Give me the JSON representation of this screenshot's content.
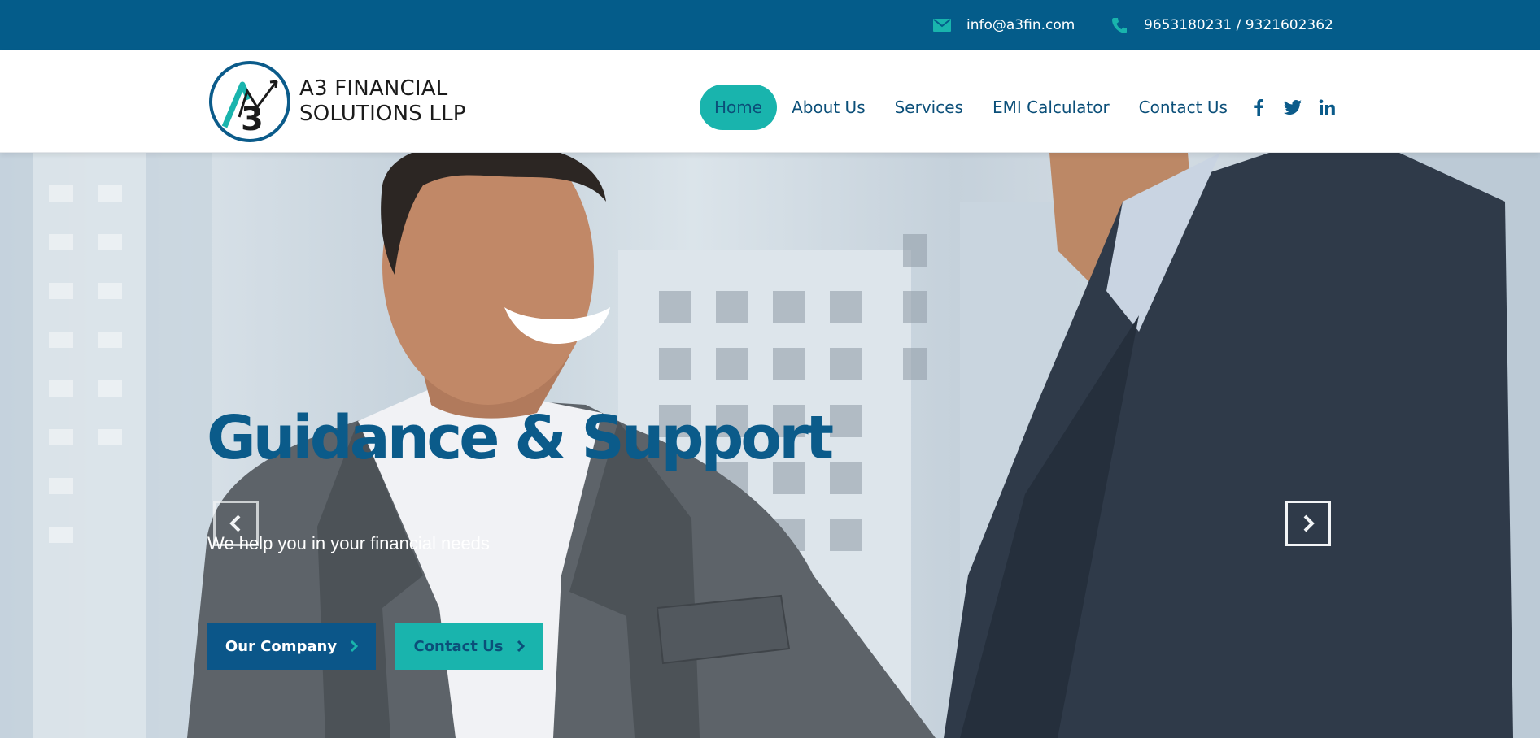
{
  "topbar": {
    "email": "info@a3fin.com",
    "phone": "9653180231 / 9321602362",
    "icons": [
      "mail-icon",
      "phone-icon"
    ]
  },
  "logo": {
    "line1": "A3 FINANCIAL",
    "line2": "SOLUTIONS LLP",
    "mark_text": "3"
  },
  "nav": {
    "items": [
      {
        "label": "Home",
        "active": true
      },
      {
        "label": "About Us"
      },
      {
        "label": "Services"
      },
      {
        "label": "EMI Calculator"
      },
      {
        "label": "Contact Us"
      }
    ],
    "social": [
      "facebook-icon",
      "twitter-icon",
      "linkedin-icon"
    ]
  },
  "hero": {
    "title": "Guidance & Support",
    "subtitle": "We help you in your financial needs",
    "buttons": {
      "company": "Our Company",
      "contact": "Contact Us"
    }
  },
  "colors": {
    "topbar": "#045c8a",
    "accent": "#19b4ad",
    "primary": "#0b5689",
    "nav_text": "#0b4f79"
  }
}
